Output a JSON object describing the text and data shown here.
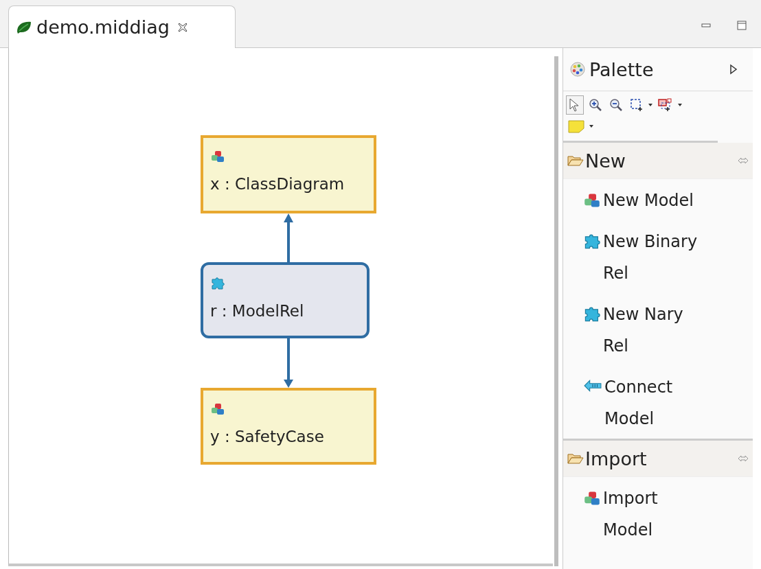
{
  "tab": {
    "title": "demo.middiag",
    "selected": true
  },
  "diagram": {
    "nodes": [
      {
        "kind": "model",
        "label": "x : ClassDiagram"
      },
      {
        "kind": "relation",
        "label": "r : ModelRel"
      },
      {
        "kind": "model",
        "label": "y : SafetyCase"
      }
    ]
  },
  "palette": {
    "title": "Palette",
    "tools": [
      {
        "kind": "select",
        "selected": true
      },
      {
        "kind": "zoom-in",
        "selected": false
      },
      {
        "kind": "zoom-out",
        "selected": false
      },
      {
        "kind": "marquee",
        "selected": false
      },
      {
        "kind": "connection-marquee",
        "selected": false
      },
      {
        "kind": "note",
        "selected": false
      }
    ],
    "drawers": [
      {
        "label": "New",
        "items": [
          {
            "kind": "model",
            "label": "New Model"
          },
          {
            "kind": "relation",
            "label": "New Binary Rel"
          },
          {
            "kind": "relation",
            "label": "New Nary Rel"
          },
          {
            "kind": "connect",
            "label": "Connect Model"
          }
        ]
      },
      {
        "label": "Import",
        "items": [
          {
            "kind": "model",
            "label": "Import Model"
          }
        ]
      }
    ]
  }
}
